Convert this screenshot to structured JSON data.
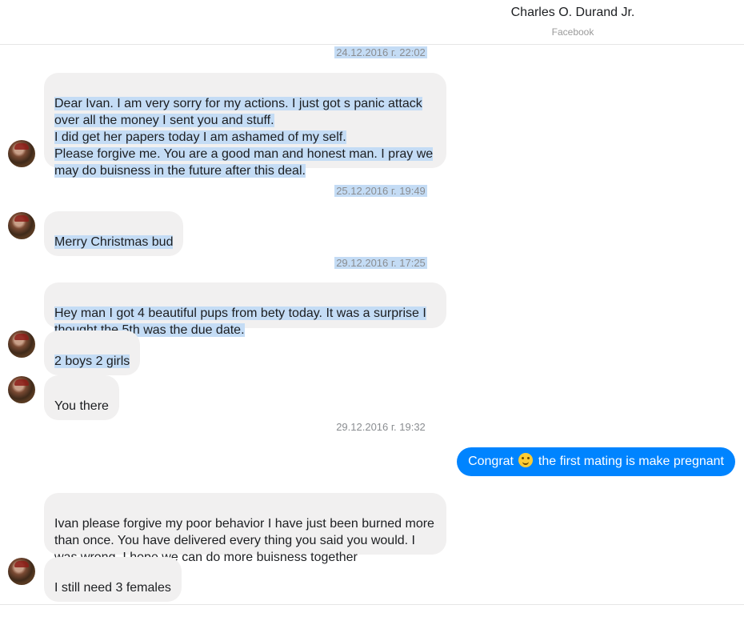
{
  "header": {
    "contact_name": "Charles O. Durand Jr.",
    "contact_sub": "Facebook"
  },
  "colors": {
    "sent_bubble": "#0084ff",
    "received_bubble": "#f1f0f0",
    "selection": "#c4dcf5"
  },
  "messages": {
    "ts1": "24.12.2016 г. 22:02",
    "m1": "Dear Ivan. I am very sorry for my actions. I just got s panic attack over all the money I sent you and stuff.\n I did get her papers today I am ashamed of my self.\n Please forgive me. You are a good man and honest man. I pray we may do buisness in the future after this deal.",
    "ts2": "25.12.2016 г. 19:49",
    "m2": "Merry Christmas bud",
    "ts3": "29.12.2016 г. 17:25",
    "m3": "Hey man I got 4 beautiful pups from bety today. It was a surprise I thought the 5th was the due date.",
    "m4": "2 boys 2 girls",
    "m5": "You there",
    "ts4": "29.12.2016 г. 19:32",
    "sent1_before": "Congrat",
    "sent1_after": "the first mating is make pregnant",
    "m6": "Ivan please forgive my poor behavior I have just been burned more than once. You have delivered every thing you said you would. I was wrong. I hope we can do more buisness together",
    "m7": "I still need 3 females"
  },
  "icons": {
    "avatar": "contact-avatar",
    "emoji": "smiley-emoji"
  }
}
